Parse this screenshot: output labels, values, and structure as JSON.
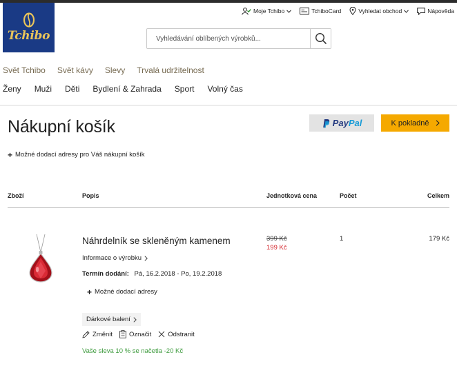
{
  "brand": {
    "name": "Tchibo",
    "color": "#1a3a85",
    "accent": "#e9c45a"
  },
  "utility_nav": [
    {
      "label": "Moje Tchibo",
      "icon": "user-check-icon"
    },
    {
      "label": "TchiboCard",
      "icon": "card-icon"
    },
    {
      "label": "Vyhledat obchod",
      "icon": "location-icon"
    },
    {
      "label": "Nápověda",
      "icon": "chat-icon"
    }
  ],
  "search": {
    "placeholder": "Vyhledávání oblíbených výrobků...",
    "icon": "search-icon"
  },
  "nav_primary": [
    "Svět Tchibo",
    "Svět kávy",
    "Slevy",
    "Trvalá udržitelnost"
  ],
  "nav_secondary": [
    "Ženy",
    "Muži",
    "Děti",
    "Bydlení & Zahrada",
    "Sport",
    "Volný čas"
  ],
  "cart": {
    "title": "Nákupní košík",
    "paypal": {
      "pay": "Pay",
      "pal": "Pal"
    },
    "checkout_label": "K pokladně",
    "delivery_addresses_label": "Možné dodací adresy pro Váš nákupní košík",
    "columns": {
      "item": "Zboží",
      "description": "Popis",
      "unit_price": "Jednotková cena",
      "quantity": "Počet",
      "total": "Celkem"
    },
    "items": [
      {
        "name": "Náhrdelník se skleněným kamenem",
        "info_label": "Informace o výrobku",
        "delivery_label": "Termín dodání:",
        "delivery_range": "Pá, 16.2.2018 - Po, 19.2.2018",
        "addresses_label": "Možné dodací adresy",
        "old_price": "399 Kč",
        "price": "199 Kč",
        "quantity": "1",
        "total": "179 Kč",
        "gift_label": "Dárkové balení",
        "actions": {
          "edit": "Změnit",
          "mark": "Označit",
          "remove": "Odstranit"
        },
        "discount_note": "Vaše sleva 10 % se načetla -20 Kč"
      }
    ]
  },
  "colors": {
    "sale_price": "#d4262c",
    "checkout": "#f5a900",
    "discount": "#3c9a3c",
    "nav_primary": "#776b52"
  }
}
